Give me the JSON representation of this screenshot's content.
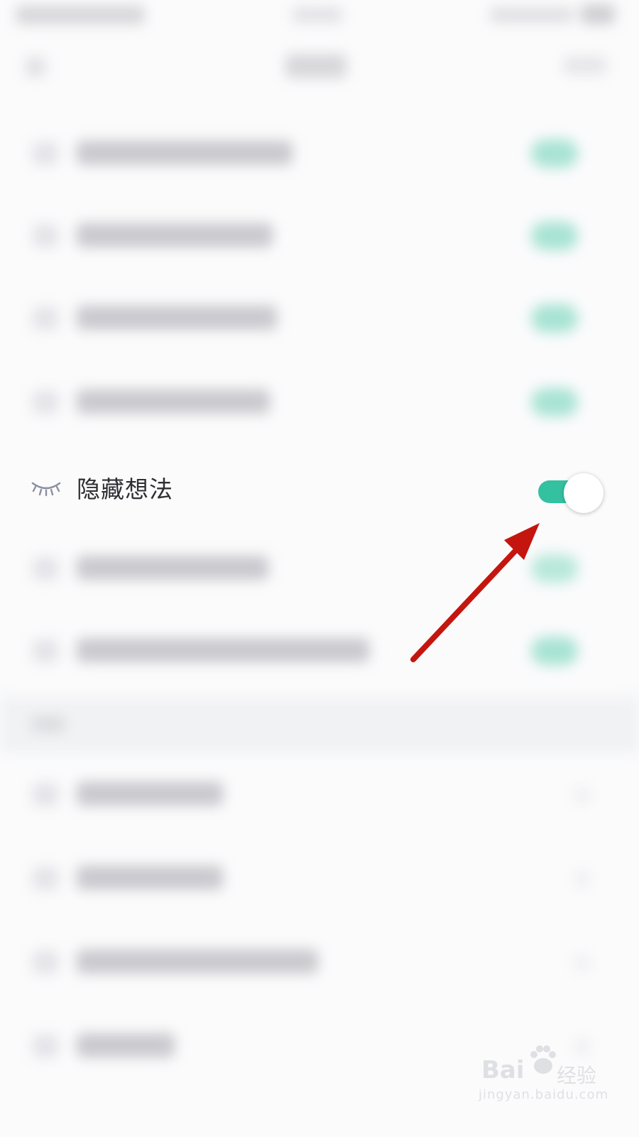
{
  "focused_setting": {
    "label": "隐藏想法",
    "icon": "eye-closed-icon",
    "toggle_on": true
  },
  "colors": {
    "toggle_on": "#33c1a0",
    "arrow": "#c4160f",
    "icon": "#8c8fa3"
  },
  "watermark": {
    "brand": "Bai",
    "brand_suffix": "经验",
    "url": "jingyan.baidu.com"
  }
}
